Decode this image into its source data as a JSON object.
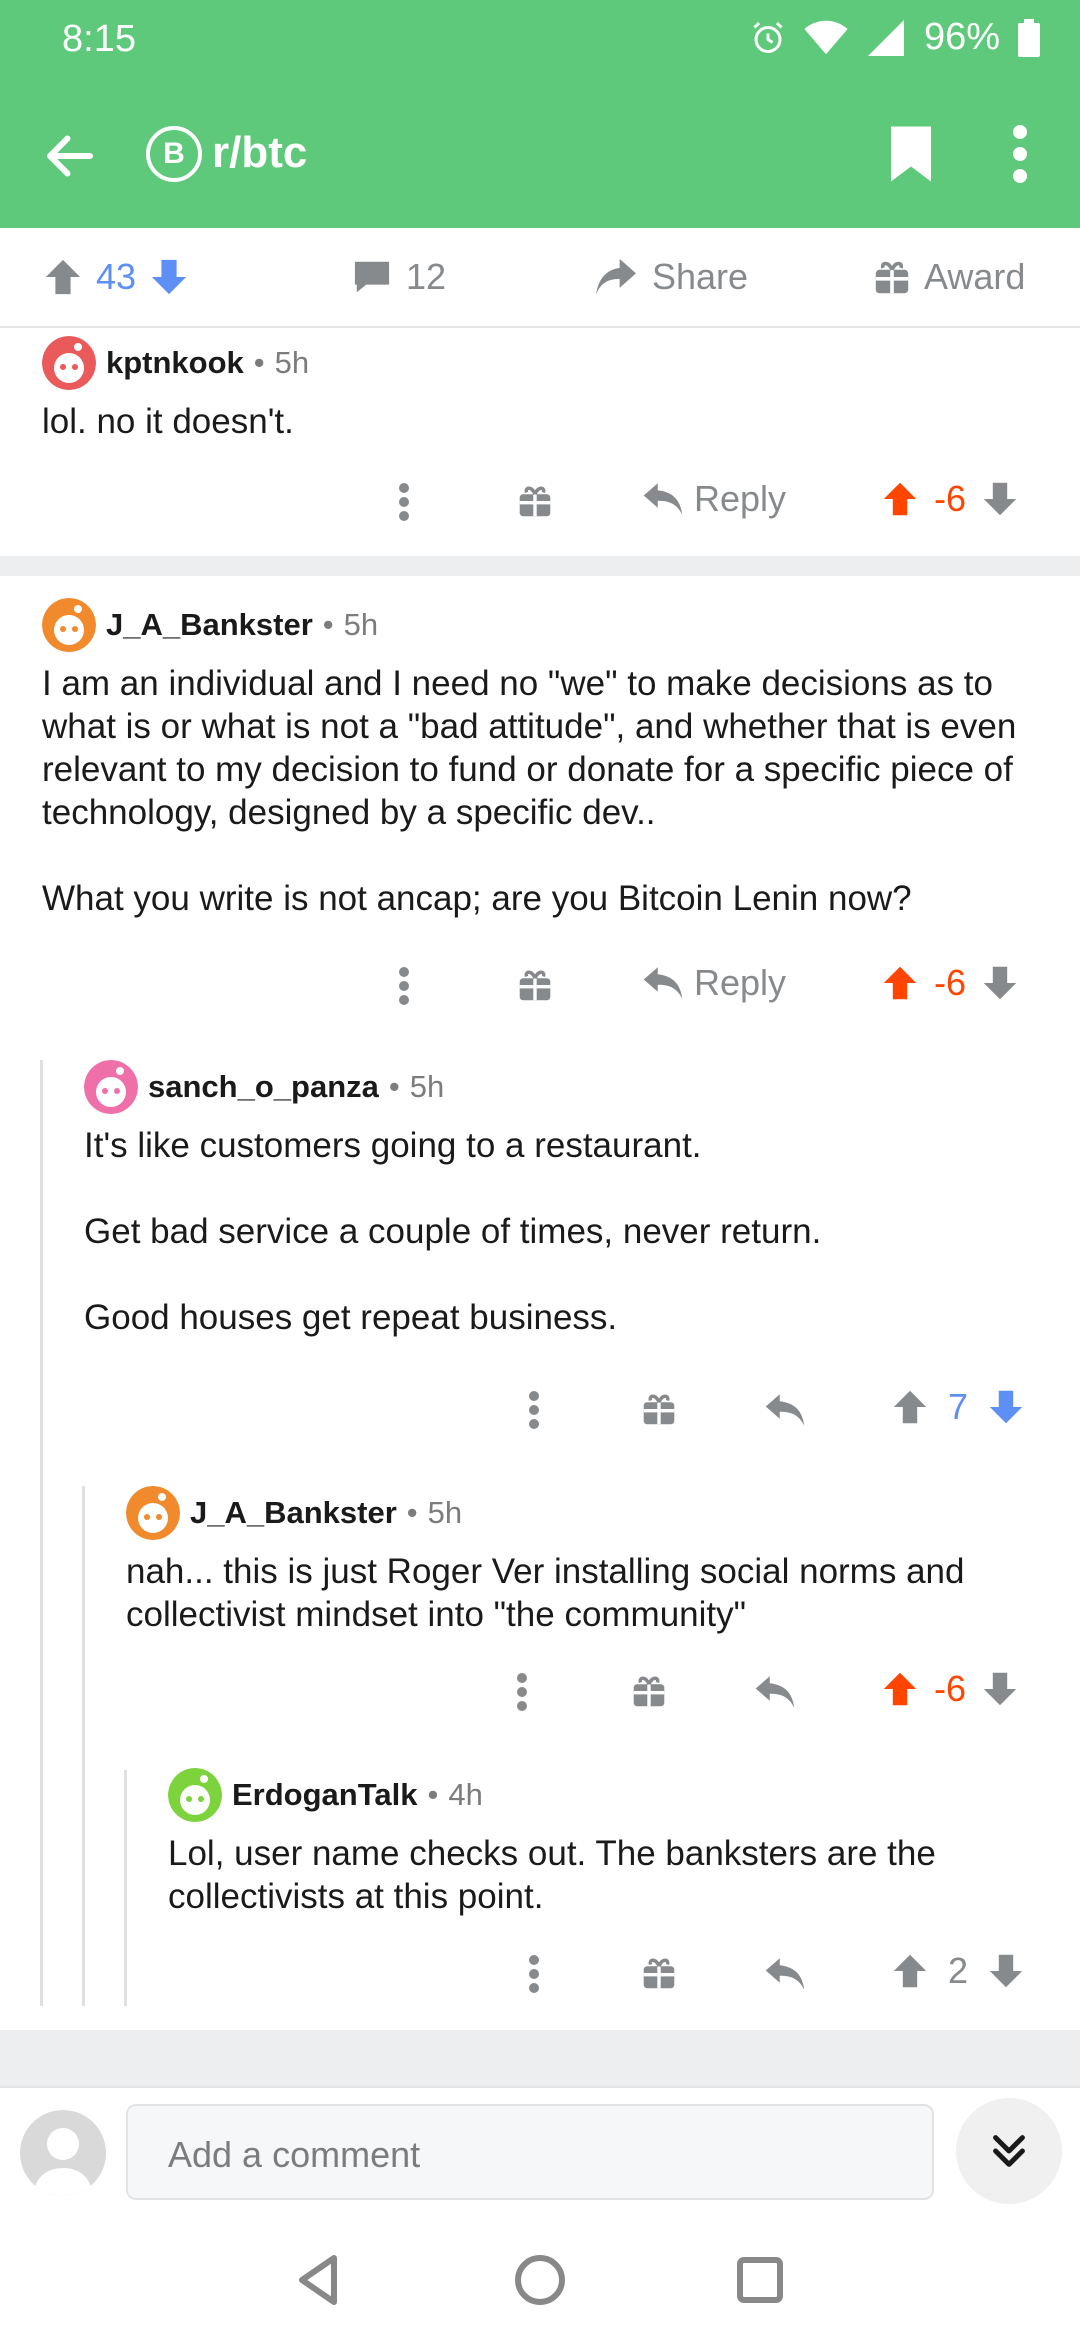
{
  "status": {
    "time": "8:15",
    "battery": "96%"
  },
  "header": {
    "subreddit": "r/btc",
    "sub_icon_glyph": "B",
    "back_icon": "arrow-left-icon",
    "bookmark_icon": "bookmark-icon",
    "more_icon": "more-vert-icon"
  },
  "post_bar": {
    "score": "43",
    "comments": "12",
    "share_label": "Share",
    "award_label": "Award"
  },
  "comments": [
    {
      "author": "kptnkook",
      "age": "5h",
      "body": [
        "lol. no it doesn't."
      ],
      "reply_label": "Reply",
      "score": "-6",
      "vote": "up"
    },
    {
      "author": "J_A_Bankster",
      "age": "5h",
      "body": [
        "I am an individual and I need no \"we\" to make decisions as to what is or what is not a \"bad attitude\", and whether that is even relevant to my decision to fund or donate for a specific piece of technology, designed by a specific dev..",
        "What you write is not ancap; are you Bitcoin Lenin now?"
      ],
      "reply_label": "Reply",
      "score": "-6",
      "vote": "up"
    },
    {
      "author": "sanch_o_panza",
      "age": "5h",
      "body": [
        "It's like customers going to a restaurant.",
        "Get bad service a couple of times, never return.",
        "Good houses get repeat business."
      ],
      "score": "7",
      "vote": "down"
    },
    {
      "author": "J_A_Bankster",
      "age": "5h",
      "body": [
        "nah... this is just Roger Ver installing social norms and collectivist mindset into \"the community\""
      ],
      "score": "-6",
      "vote": "up"
    },
    {
      "author": "ErdoganTalk",
      "age": "4h",
      "body": [
        "Lol, user name checks out. The banksters are the collectivists at this point."
      ],
      "score": "2",
      "vote": "none"
    }
  ],
  "separator": "•",
  "compose": {
    "placeholder": "Add a comment"
  },
  "colors": {
    "header": "#5ec97a",
    "upvote": "#ff4500",
    "downvote": "#5d8ff5",
    "muted": "#878a8c"
  }
}
